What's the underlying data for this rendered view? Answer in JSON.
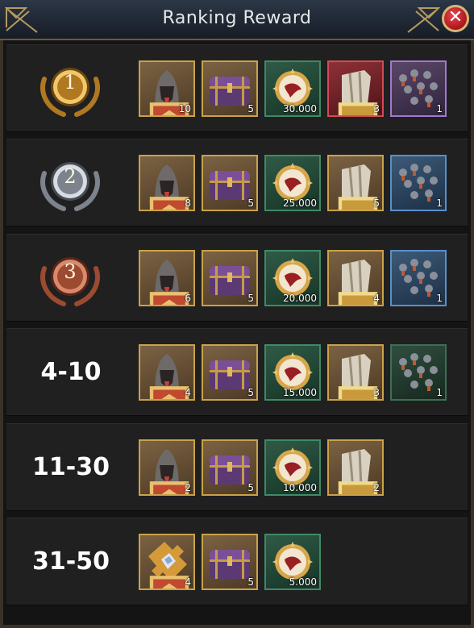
{
  "dialog": {
    "title": "Ranking Reward",
    "close_icon": "close-icon"
  },
  "rows": [
    {
      "rank_label": "",
      "medal": "gold",
      "medal_text": "1",
      "items": [
        {
          "icon": "hero-icon",
          "frame": "gold",
          "qty": "10"
        },
        {
          "icon": "chest-icon",
          "frame": "gold",
          "qty": "5"
        },
        {
          "icon": "coin-icon",
          "frame": "green",
          "qty": "30.000"
        },
        {
          "icon": "shield-icon",
          "frame": "red",
          "qty": "3"
        },
        {
          "icon": "army-icon",
          "frame": "purple",
          "qty": "1"
        }
      ]
    },
    {
      "rank_label": "",
      "medal": "silver",
      "medal_text": "2",
      "items": [
        {
          "icon": "hero-icon",
          "frame": "gold",
          "qty": "8"
        },
        {
          "icon": "chest-icon",
          "frame": "gold",
          "qty": "5"
        },
        {
          "icon": "coin-icon",
          "frame": "green",
          "qty": "25.000"
        },
        {
          "icon": "shield-icon",
          "frame": "gold",
          "qty": "5"
        },
        {
          "icon": "army-icon",
          "frame": "blue",
          "qty": "1"
        }
      ]
    },
    {
      "rank_label": "",
      "medal": "bronze",
      "medal_text": "3",
      "items": [
        {
          "icon": "hero-icon",
          "frame": "gold",
          "qty": "6"
        },
        {
          "icon": "chest-icon",
          "frame": "gold",
          "qty": "5"
        },
        {
          "icon": "coin-icon",
          "frame": "green",
          "qty": "20.000"
        },
        {
          "icon": "shield-icon",
          "frame": "gold",
          "qty": "4"
        },
        {
          "icon": "army-icon",
          "frame": "blue",
          "qty": "1"
        }
      ]
    },
    {
      "rank_label": "4-10",
      "medal": "",
      "medal_text": "",
      "items": [
        {
          "icon": "hero-icon",
          "frame": "gold",
          "qty": "4"
        },
        {
          "icon": "chest-icon",
          "frame": "gold",
          "qty": "5"
        },
        {
          "icon": "coin-icon",
          "frame": "green",
          "qty": "15.000"
        },
        {
          "icon": "shield-icon",
          "frame": "gold",
          "qty": "3"
        },
        {
          "icon": "army-icon",
          "frame": "dkgreen",
          "qty": "1"
        }
      ]
    },
    {
      "rank_label": "11-30",
      "medal": "",
      "medal_text": "",
      "items": [
        {
          "icon": "hero-icon",
          "frame": "gold",
          "qty": "2"
        },
        {
          "icon": "chest-icon",
          "frame": "gold",
          "qty": "5"
        },
        {
          "icon": "coin-icon",
          "frame": "green",
          "qty": "10.000"
        },
        {
          "icon": "shield-icon",
          "frame": "gold",
          "qty": "2"
        }
      ]
    },
    {
      "rank_label": "31-50",
      "medal": "",
      "medal_text": "",
      "items": [
        {
          "icon": "puzzle-icon",
          "frame": "gold",
          "qty": "4"
        },
        {
          "icon": "chest-icon",
          "frame": "gold",
          "qty": "5"
        },
        {
          "icon": "coin-icon",
          "frame": "green",
          "qty": "5.000"
        }
      ]
    }
  ],
  "colors": {
    "gold_medal": "#c8922e",
    "silver_medal": "#8a9099",
    "bronze_medal": "#a9553a",
    "close_button": "#c0262d",
    "header": "#222c39"
  }
}
